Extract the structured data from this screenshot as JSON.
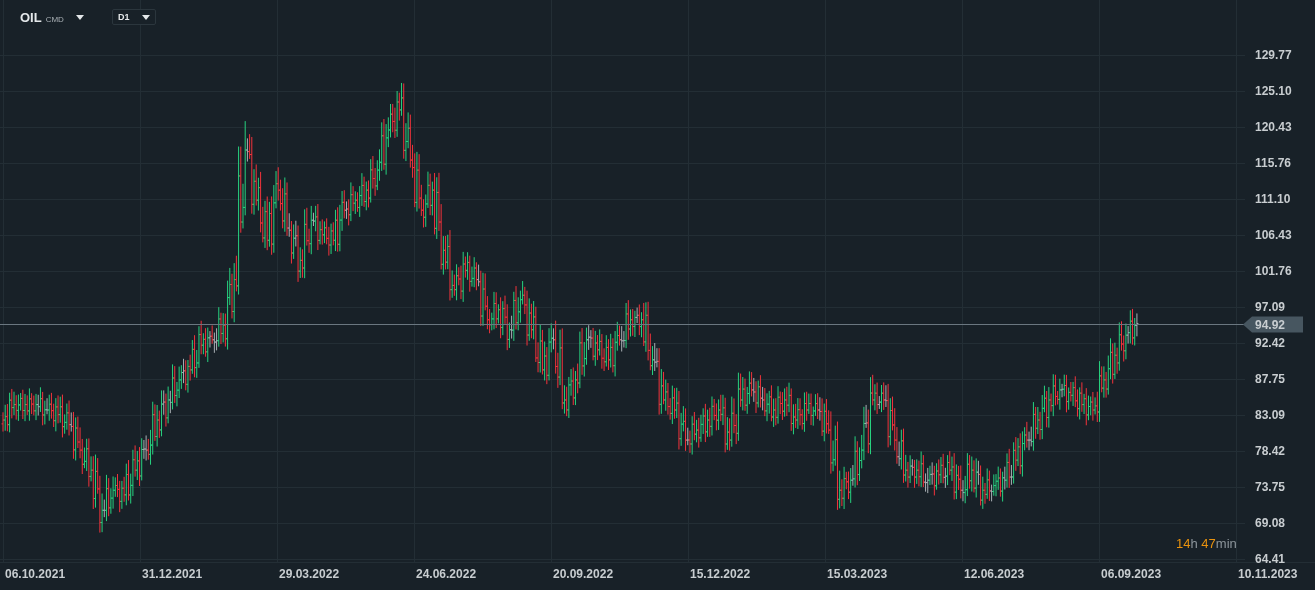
{
  "instrument": {
    "symbol": "OIL",
    "market": "CMD",
    "timeframe": "D1"
  },
  "chart": {
    "last_price": "94.92",
    "countdown": {
      "hours": "14",
      "hours_unit": "h",
      "minutes": "47",
      "minutes_unit": "min"
    },
    "price_axis": [
      "129.77",
      "125.10",
      "120.43",
      "115.76",
      "111.10",
      "106.43",
      "101.76",
      "97.09",
      "92.42",
      "87.75",
      "83.09",
      "78.42",
      "73.75",
      "69.08",
      "64.41"
    ],
    "date_axis": [
      "06.10.2021",
      "31.12.2021",
      "29.03.2022",
      "24.06.2022",
      "20.09.2022",
      "15.12.2022",
      "15.03.2023",
      "12.06.2023",
      "06.09.2023",
      "10.11.2023"
    ]
  }
}
